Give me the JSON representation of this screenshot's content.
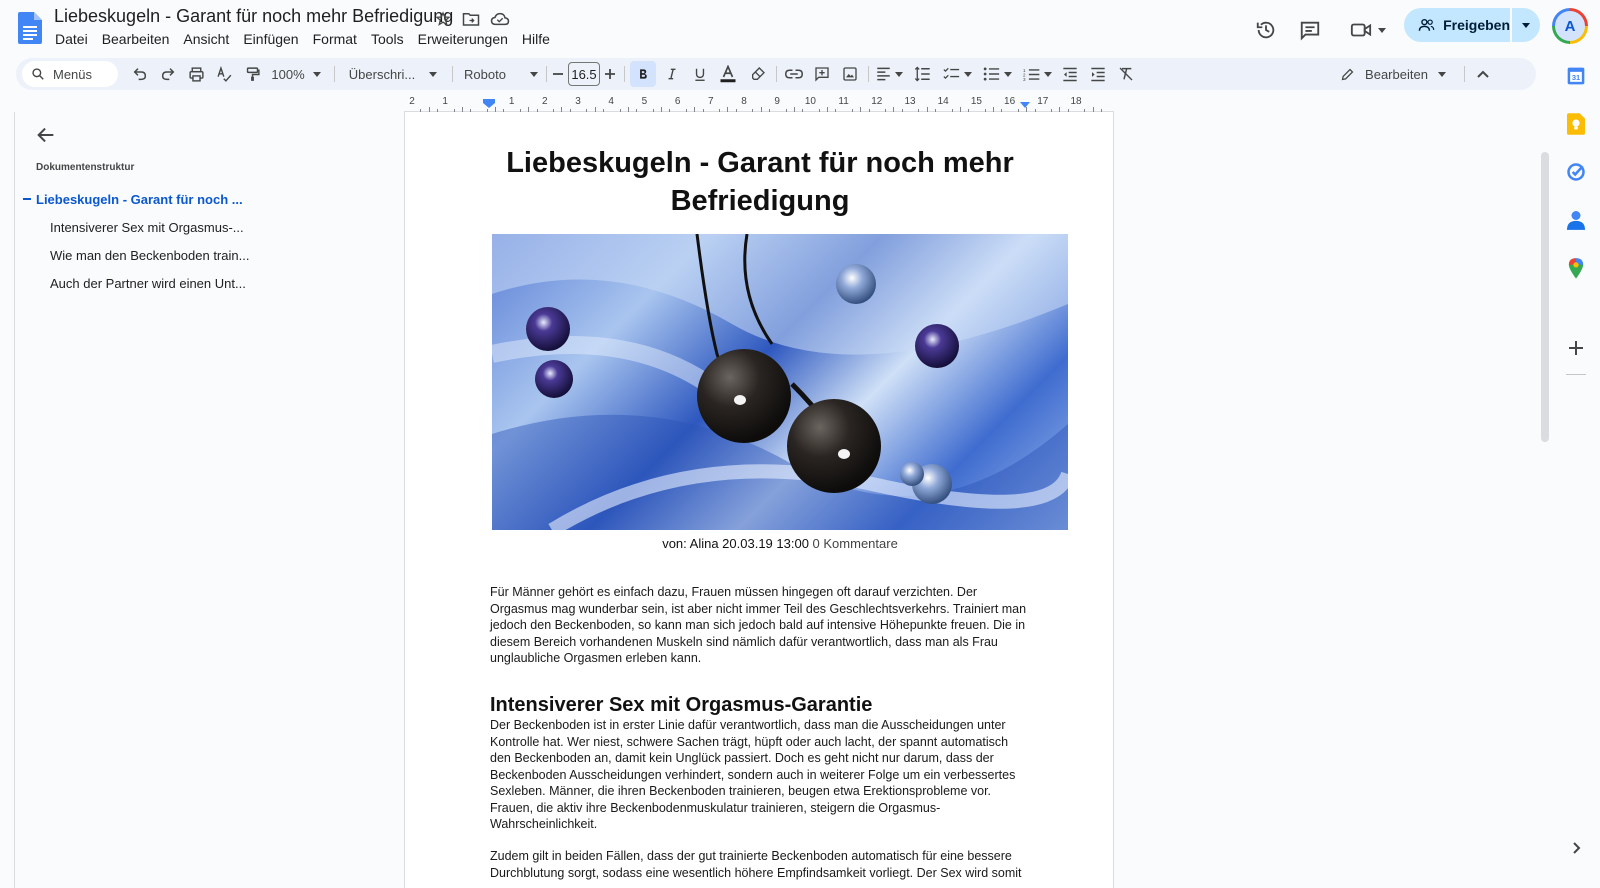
{
  "doc": {
    "title": "Liebeskugeln - Garant für noch mehr Befriedigung",
    "menu": [
      "Datei",
      "Bearbeiten",
      "Ansicht",
      "Einfügen",
      "Format",
      "Tools",
      "Erweiterungen",
      "Hilfe"
    ]
  },
  "header": {
    "share_label": "Freigeben",
    "avatar_initial": "A"
  },
  "toolbar": {
    "search_label": "Menüs",
    "zoom": "100%",
    "style": "Überschri...",
    "font": "Roboto",
    "font_size": "16.5",
    "mode": "Bearbeiten"
  },
  "ruler": {
    "labels": [
      "2",
      "1",
      "1",
      "2",
      "3",
      "4",
      "5",
      "6",
      "7",
      "8",
      "9",
      "10",
      "11",
      "12",
      "13",
      "14",
      "15",
      "16",
      "17",
      "18"
    ]
  },
  "outline": {
    "title": "Dokumentenstruktur",
    "items": [
      {
        "label": "Liebeskugeln - Garant für noch ...",
        "active": true
      },
      {
        "label": "Intensiverer Sex mit Orgasmus-...",
        "active": false
      },
      {
        "label": "Wie man den Beckenboden train...",
        "active": false
      },
      {
        "label": "Auch der Partner wird einen Unt...",
        "active": false
      }
    ]
  },
  "page": {
    "heading": "Liebeskugeln - Garant für noch mehr Befriedigung",
    "byline_main": "von: Alina 20.03.19 13:00",
    "byline_comments": "0 Kommentare",
    "para1": "Für Männer gehört es einfach dazu, Frauen müssen hingegen oft darauf verzichten. Der Orgasmus mag wunderbar sein, ist aber nicht immer Teil des Geschlechtsverkehrs. Trainiert man jedoch den Beckenboden, so kann man sich jedoch bald auf intensive Höhepunkte freuen. Die in diesem Bereich vorhandenen Muskeln sind nämlich dafür verantwortlich, dass man als Frau unglaubliche Orgasmen erleben kann.",
    "h2": "Intensiverer Sex mit Orgasmus-Garantie",
    "para2": "Der Beckenboden ist in erster Linie dafür verantwortlich, dass man die Ausscheidungen unter Kontrolle hat. Wer niest, schwere Sachen trägt, hüpft oder auch lacht, der spannt automatisch den Beckenboden an, damit kein Unglück passiert. Doch es geht nicht nur darum, dass der Beckenboden Ausscheidungen verhindert, sondern auch in weiterer Folge um ein verbessertes Sexleben. Männer, die ihren Beckenboden trainieren, beugen etwa Erektionsprobleme vor. Frauen, die aktiv ihre Beckenbodenmuskulatur trainieren, steigern die Orgasmus-Wahrscheinlichkeit.",
    "para3": "Zudem gilt in beiden Fällen, dass der gut trainierte Beckenboden automatisch für eine bessere Durchblutung sorgt, sodass eine wesentlich höhere Empfindsamkeit vorliegt. Der Sex wird somit"
  },
  "colors": {
    "accent": "#0b57d0",
    "share_bg": "#c2e7ff",
    "toolbar_bg": "#edf2fa"
  }
}
